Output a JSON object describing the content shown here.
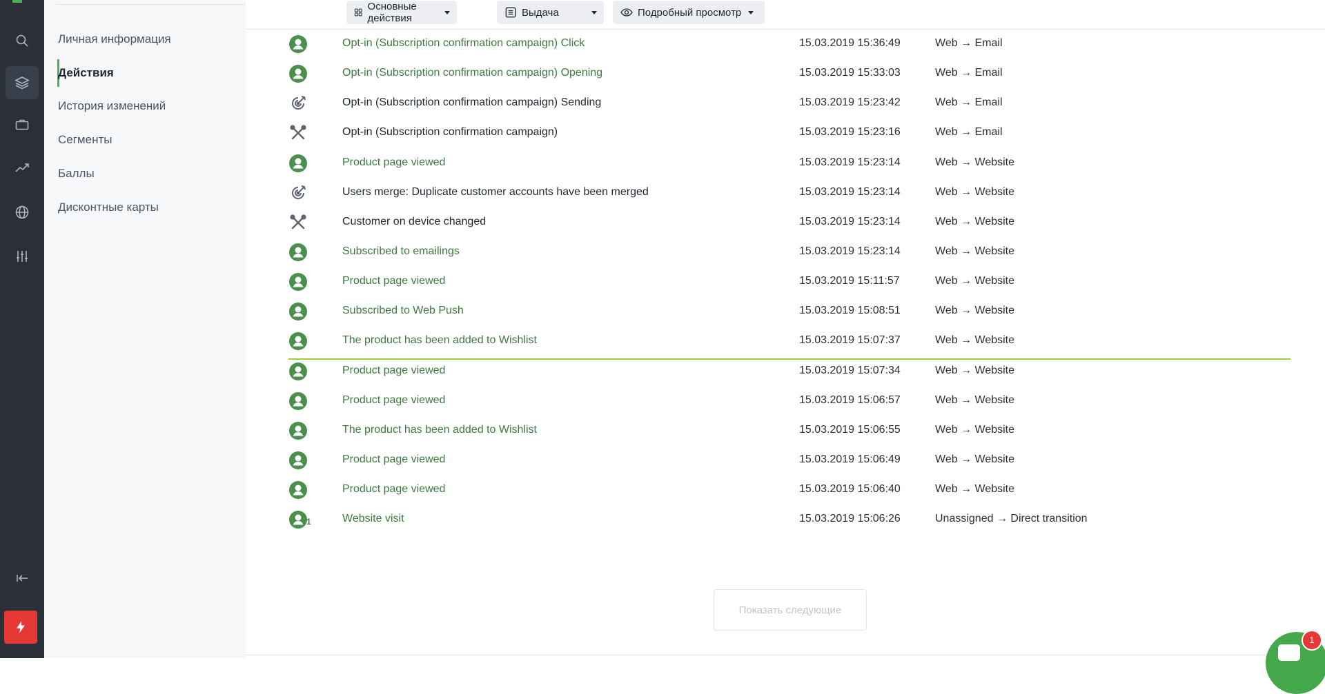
{
  "rail": {
    "items": [
      "search-icon",
      "layers-icon",
      "briefcase-icon",
      "trend-icon",
      "globe-icon",
      "sliders-icon"
    ],
    "collapse_icon": "collapse-left-icon",
    "bolt_icon": "lightning-icon",
    "accent": "#e53935"
  },
  "subnav": {
    "items": [
      {
        "label": "Личная информация"
      },
      {
        "label": "Действия"
      },
      {
        "label": "История изменений"
      },
      {
        "label": "Сегменты"
      },
      {
        "label": "Баллы"
      },
      {
        "label": "Дисконтные карты"
      }
    ],
    "active_index": 1,
    "accent": "#4caf50"
  },
  "toolbar": {
    "actions_label": "Основные действия",
    "output_label": "Выдача",
    "view_label": "Подробный просмотр"
  },
  "rows": [
    {
      "icon": "user-icon",
      "name": "Opt-in (Subscription confirmation campaign) Click",
      "link": true,
      "time": "15.03.2019 15:36:49",
      "channel": "Web → Email"
    },
    {
      "icon": "user-icon",
      "name": "Opt-in (Subscription confirmation campaign) Opening",
      "link": true,
      "time": "15.03.2019 15:33:03",
      "channel": "Web → Email"
    },
    {
      "icon": "target-icon",
      "name": "Opt-in (Subscription confirmation campaign) Sending",
      "link": false,
      "time": "15.03.2019 15:23:42",
      "channel": "Web → Email"
    },
    {
      "icon": "tools-icon",
      "name": "Opt-in (Subscription confirmation campaign)",
      "link": false,
      "time": "15.03.2019 15:23:16",
      "channel": "Web → Email"
    },
    {
      "icon": "user-icon",
      "name": "Product page viewed",
      "link": true,
      "time": "15.03.2019 15:23:14",
      "channel": "Web → Website"
    },
    {
      "icon": "target-icon",
      "name": "Users merge: Duplicate customer accounts have been merged",
      "link": false,
      "time": "15.03.2019 15:23:14",
      "channel": "Web → Website"
    },
    {
      "icon": "tools-icon",
      "name": "Customer on device changed",
      "link": false,
      "time": "15.03.2019 15:23:14",
      "channel": "Web → Website"
    },
    {
      "icon": "user-icon",
      "name": "Subscribed to emailings",
      "link": true,
      "time": "15.03.2019 15:23:14",
      "channel": "Web → Website"
    },
    {
      "icon": "user-icon",
      "name": "Product page viewed",
      "link": true,
      "time": "15.03.2019 15:11:57",
      "channel": "Web → Website"
    },
    {
      "icon": "user-icon",
      "name": "Subscribed to Web Push",
      "link": true,
      "time": "15.03.2019 15:08:51",
      "channel": "Web → Website"
    },
    {
      "icon": "user-icon",
      "name": "The product has been added to Wishlist",
      "link": true,
      "time": "15.03.2019 15:07:37",
      "channel": "Web → Website"
    },
    {
      "icon": "user-icon",
      "name": "Product page viewed",
      "link": true,
      "time": "15.03.2019 15:07:34",
      "channel": "Web → Website"
    },
    {
      "icon": "user-icon",
      "name": "Product page viewed",
      "link": true,
      "time": "15.03.2019 15:06:57",
      "channel": "Web → Website"
    },
    {
      "icon": "user-icon",
      "name": "The product has been added to Wishlist",
      "link": true,
      "time": "15.03.2019 15:06:55",
      "channel": "Web → Website"
    },
    {
      "icon": "user-icon",
      "name": "Product page viewed",
      "link": true,
      "time": "15.03.2019 15:06:49",
      "channel": "Web → Website"
    },
    {
      "icon": "user-icon",
      "name": "Product page viewed",
      "link": true,
      "time": "15.03.2019 15:06:40",
      "channel": "Web → Website"
    },
    {
      "icon": "user-icon",
      "name": "Website visit",
      "link": true,
      "badge": "1",
      "time": "15.03.2019 15:06:26",
      "channel": "Unassigned → Direct transition"
    }
  ],
  "more_button": "Показать следующие",
  "chat": {
    "count": "1",
    "icon": "chat-icon"
  },
  "colors": {
    "link": "#3d7a3f",
    "divider": "#9ccc3f",
    "icon_green": "#4a8f4c"
  }
}
